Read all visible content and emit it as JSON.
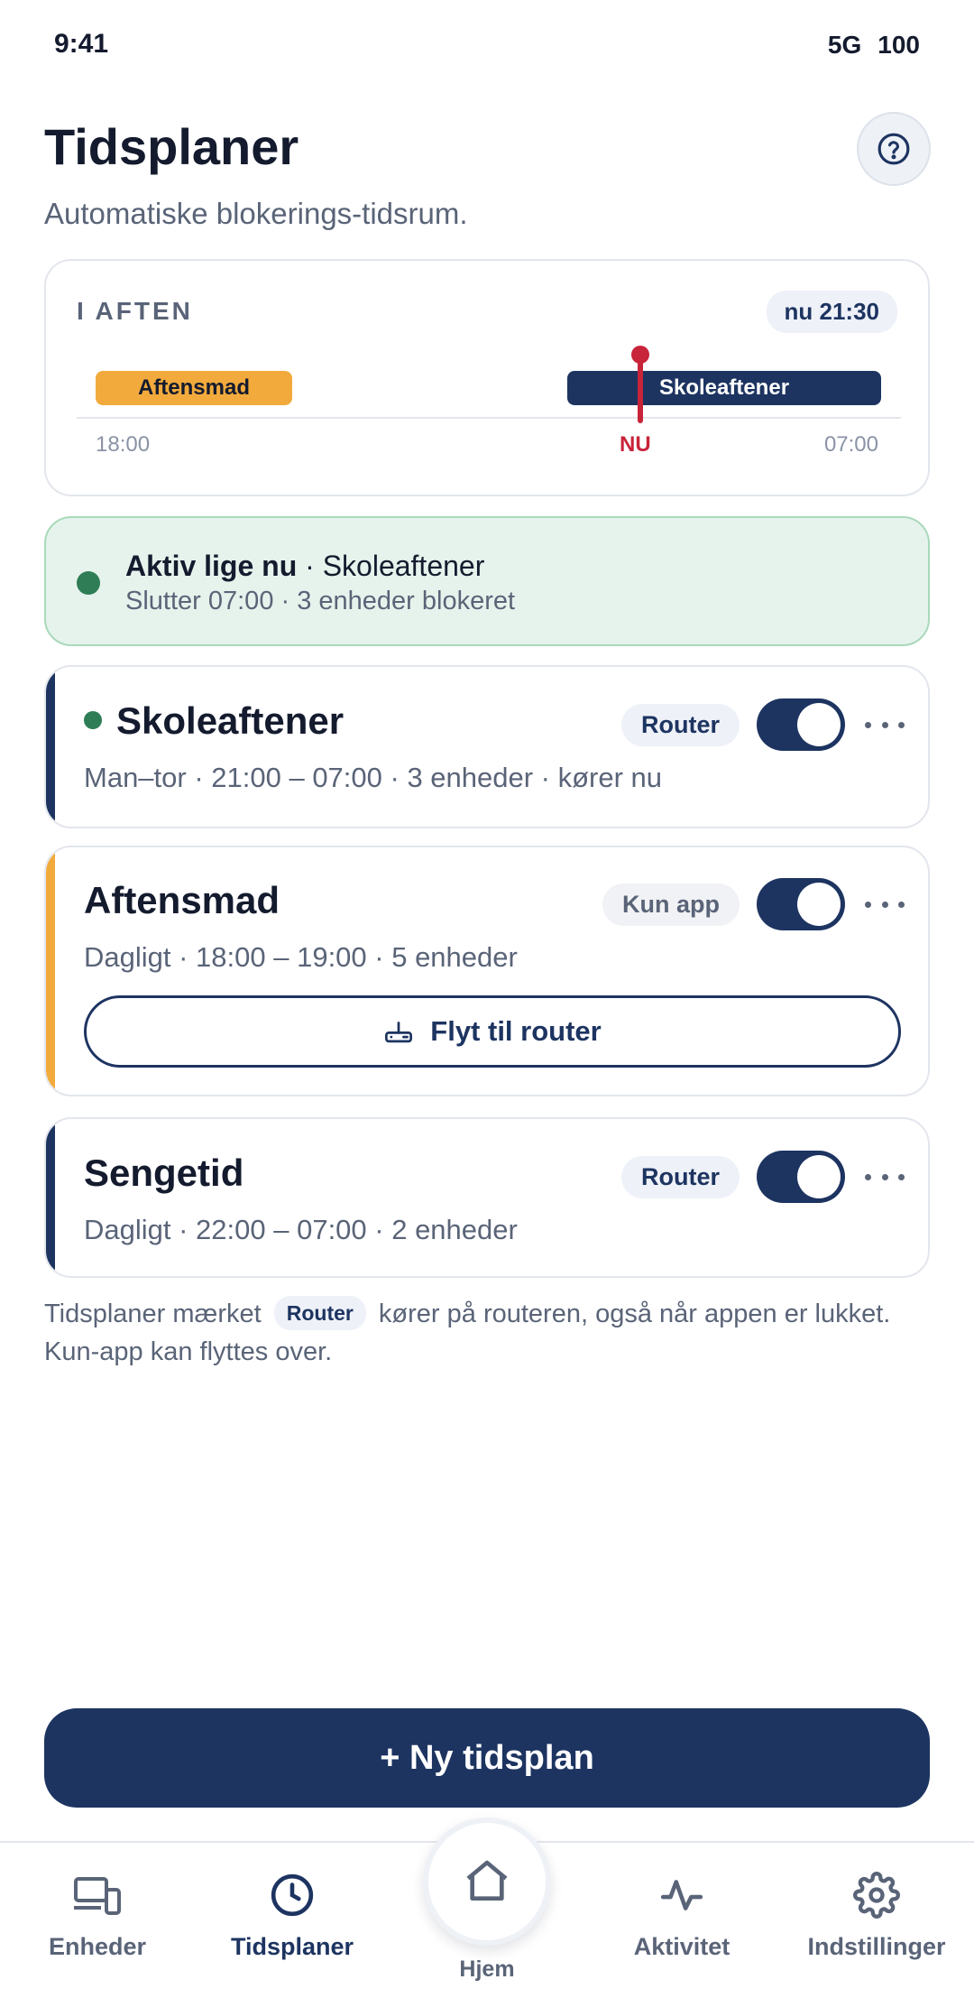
{
  "status_bar": {
    "time": "9:41",
    "network": "5G",
    "battery": "100"
  },
  "header": {
    "title": "Tidsplaner",
    "subtitle": "Automatiske blokerings-tidsrum.",
    "help_icon": "question-circle-icon"
  },
  "timeline": {
    "heading": "I AFTEN",
    "now_badge": "nu 21:30",
    "bars": [
      {
        "label": "Aftensmad",
        "color": "#f2aa3c"
      },
      {
        "label": "Skoleaftener",
        "color": "#1d3461"
      }
    ],
    "ticks": {
      "start": "18:00",
      "now": "NU",
      "end": "07:00"
    },
    "now_color": "#c8243a"
  },
  "active_banner": {
    "bold": "Aktiv lige nu",
    "rest": " · Skoleaftener",
    "detail": "Slutter 07:00 · 3 enheder blokeret"
  },
  "schedules": [
    {
      "name": "Skoleaftener",
      "meta": "Man–tor · 21:00 – 07:00 · 3 enheder · kører nu",
      "badge": "Router",
      "accent": "#1d3461",
      "enabled": true,
      "live": true
    },
    {
      "name": "Aftensmad",
      "meta": "Dagligt · 18:00 – 19:00 · 5 enheder",
      "badge": "Kun app",
      "accent": "#f2aa3c",
      "enabled": true,
      "action": "Flyt til router"
    },
    {
      "name": "Sengetid",
      "meta": "Dagligt · 22:00 – 07:00 · 2 enheder",
      "badge": "Router",
      "accent": "#1d3461",
      "enabled": true
    }
  ],
  "footnote": {
    "before": "Tidsplaner mærket",
    "badge": "Router",
    "after": "kører på routeren, også når appen er lukket. Kun-app kan flyttes over."
  },
  "new_button": "+ Ny tidsplan",
  "nav": {
    "items": [
      {
        "label": "Enheder",
        "icon": "devices-icon"
      },
      {
        "label": "Tidsplaner",
        "icon": "clock-icon",
        "active": true
      },
      {
        "label": "Hjem",
        "icon": "home-icon"
      },
      {
        "label": "Aktivitet",
        "icon": "activity-icon"
      },
      {
        "label": "Indstillinger",
        "icon": "gear-icon"
      }
    ]
  }
}
